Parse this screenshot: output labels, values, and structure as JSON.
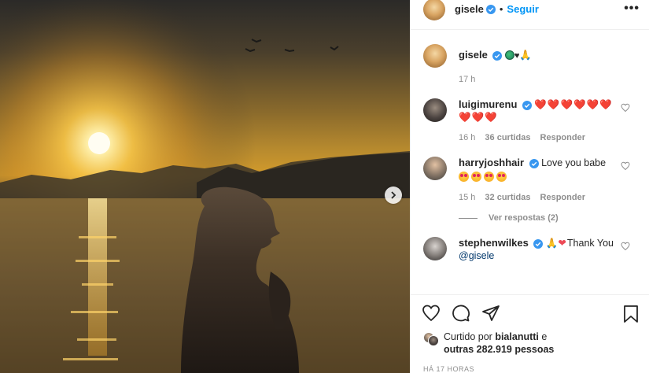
{
  "post": {
    "author": "gisele",
    "follow_label": "Seguir",
    "dot": "•",
    "more": "•••"
  },
  "caption": {
    "username": "gisele",
    "emojis": "🙏",
    "time": "17 h"
  },
  "comments": [
    {
      "username": "luigimurenu",
      "text": "❤️❤️❤️❤️❤️❤️❤️❤️❤️",
      "time": "16 h",
      "likes": "36 curtidas",
      "reply": "Responder"
    },
    {
      "username": "harryjoshhair",
      "text": "Love you babe",
      "time": "15 h",
      "likes": "32 curtidas",
      "reply": "Responder"
    },
    {
      "username": "stephenwilkes",
      "text_after": "Thank You",
      "mention": "@gisele"
    }
  ],
  "view_replies": "Ver respostas (2)",
  "liked_by": {
    "prefix": "Curtido por",
    "user": "bialanutti",
    "conj": "e",
    "others": "outras 282.919 pessoas"
  },
  "time_ago": "HÁ 17 HORAS",
  "icons": {
    "like": "heart-outline-icon",
    "comment": "comment-bubble-icon",
    "share": "paper-plane-icon",
    "save": "bookmark-icon",
    "verified": "verified-badge-icon",
    "next": "chevron-right-icon"
  },
  "colors": {
    "link": "#0095f6",
    "heart": "#ed4956",
    "muted": "#8e8e8e"
  }
}
